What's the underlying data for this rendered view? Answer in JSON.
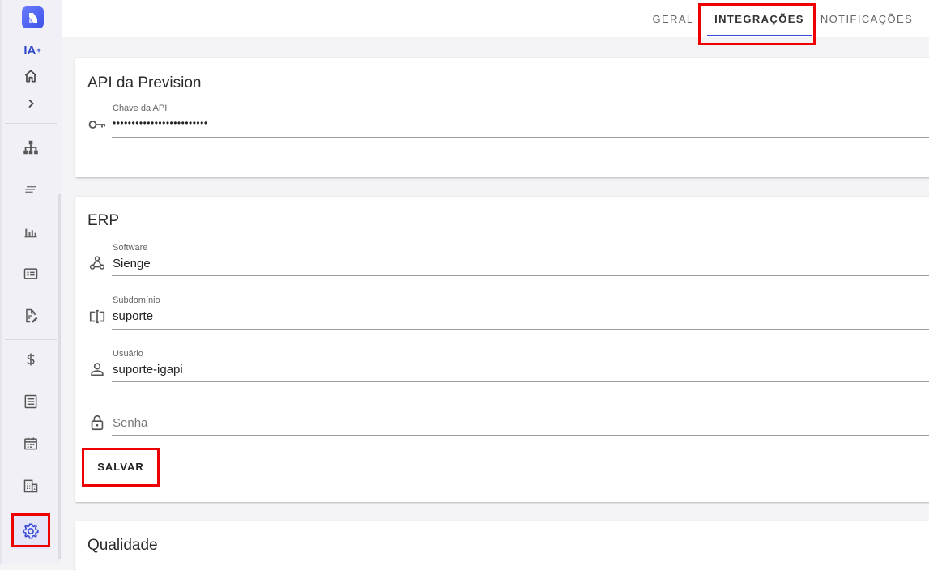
{
  "tabs": [
    {
      "label": "GERAL",
      "active": false
    },
    {
      "label": "INTEGRAÇÕES",
      "active": true
    },
    {
      "label": "NOTIFICAÇÕES",
      "active": false
    }
  ],
  "sidebar": {
    "ia_label": "IA",
    "ia_sup": "+",
    "items": [
      {
        "icon": "home-icon"
      },
      {
        "icon": "chevron-right-icon"
      },
      {
        "icon": "org-chart-icon"
      },
      {
        "icon": "lines-icon"
      },
      {
        "icon": "bar-chart-icon"
      },
      {
        "icon": "card-list-icon"
      },
      {
        "icon": "document-edit-icon"
      },
      {
        "icon": "dollar-icon"
      },
      {
        "icon": "form-icon"
      },
      {
        "icon": "calendar-icon"
      },
      {
        "icon": "building-icon"
      },
      {
        "icon": "gear-icon",
        "selected": true
      }
    ]
  },
  "api_card": {
    "title": "API da Prevision",
    "key_label": "Chave da API",
    "key_value": "•••••••••••••••••••••••••"
  },
  "erp_card": {
    "title": "ERP",
    "software_label": "Software",
    "software_value": "Sienge",
    "subdomain_label": "Subdomínio",
    "subdomain_value": "suporte",
    "user_label": "Usuário",
    "user_value": "suporte-igapi",
    "password_placeholder": "Senha",
    "save_label": "SALVAR"
  },
  "quality_card": {
    "title": "Qualidade"
  },
  "colors": {
    "accent": "#3949d8",
    "highlight_box": "#ee0000"
  }
}
